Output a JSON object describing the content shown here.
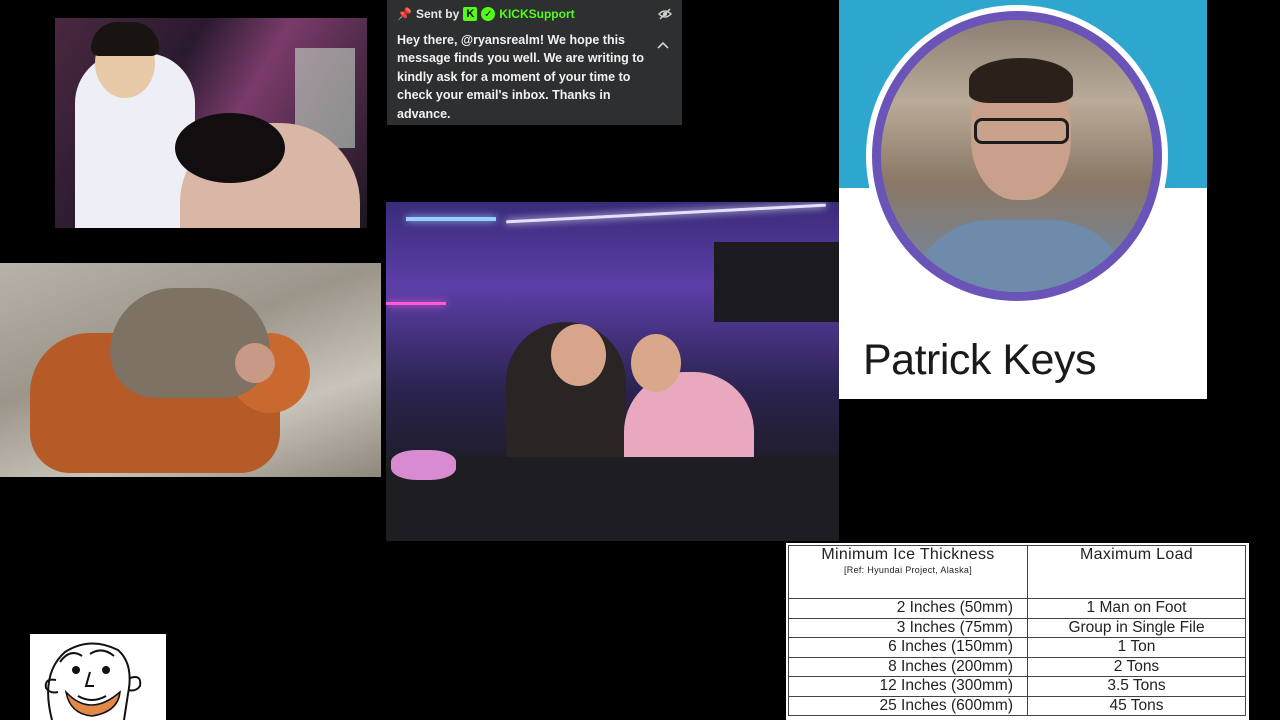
{
  "chat": {
    "sent_by_label": "Sent by",
    "kick_badge": "K",
    "sender_name": "KICKSupport",
    "message": "Hey there, @ryansrealm! We hope this message finds you well. We are writing to kindly ask for a moment of your time to check your email's inbox. Thanks in advance.",
    "icons": [
      "pin-icon",
      "kick-logo-icon",
      "verified-badge-icon",
      "hide-eye-icon",
      "chevron-up-icon"
    ],
    "accent_color": "#53fc18"
  },
  "profile": {
    "name": "Patrick Keys",
    "banner_color": "#2ea7cf",
    "ring_color": "#6b54b8"
  },
  "ice_table": {
    "headers": {
      "col1": "Minimum Ice Thickness",
      "col1_ref": "[Ref: Hyundai Project, Alaska]",
      "col2": "Maximum Load"
    },
    "rows": [
      {
        "thickness": "2 Inches (50mm)",
        "load": "1 Man on Foot"
      },
      {
        "thickness": "3 Inches (75mm)",
        "load": "Group in Single File"
      },
      {
        "thickness": "6 Inches (150mm)",
        "load": "1 Ton"
      },
      {
        "thickness": "8 Inches (200mm)",
        "load": "2 Tons"
      },
      {
        "thickness": "12 Inches (300mm)",
        "load": "3.5 Tons"
      },
      {
        "thickness": "25 Inches (600mm)",
        "load": "45 Tons"
      }
    ]
  }
}
